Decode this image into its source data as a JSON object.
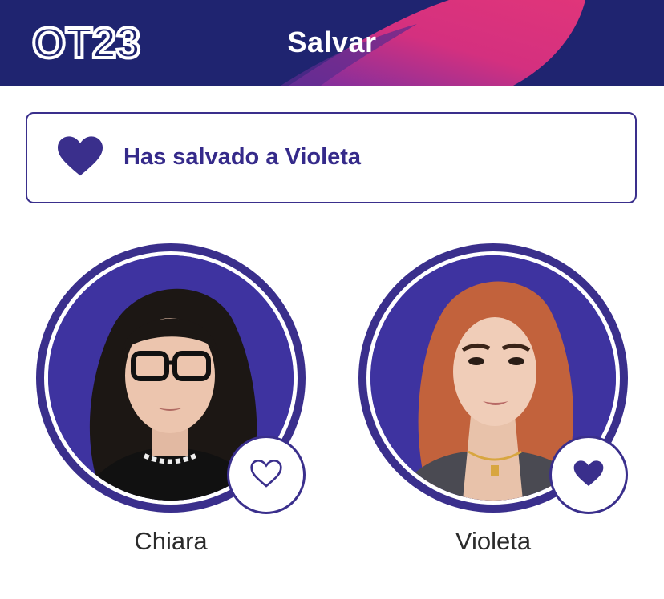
{
  "header": {
    "logo_text": "OT23",
    "title": "Salvar"
  },
  "banner": {
    "message": "Has salvado a Violeta",
    "icon": "heart-filled-icon"
  },
  "contestants": [
    {
      "name": "Chiara",
      "saved": false,
      "icon": "heart-outline-icon"
    },
    {
      "name": "Violeta",
      "saved": true,
      "icon": "heart-filled-icon"
    }
  ],
  "colors": {
    "header_bg": "#1f2470",
    "accent": "#3a2f8c",
    "swoosh": "#d4307f",
    "banner_text": "#352a8a"
  }
}
